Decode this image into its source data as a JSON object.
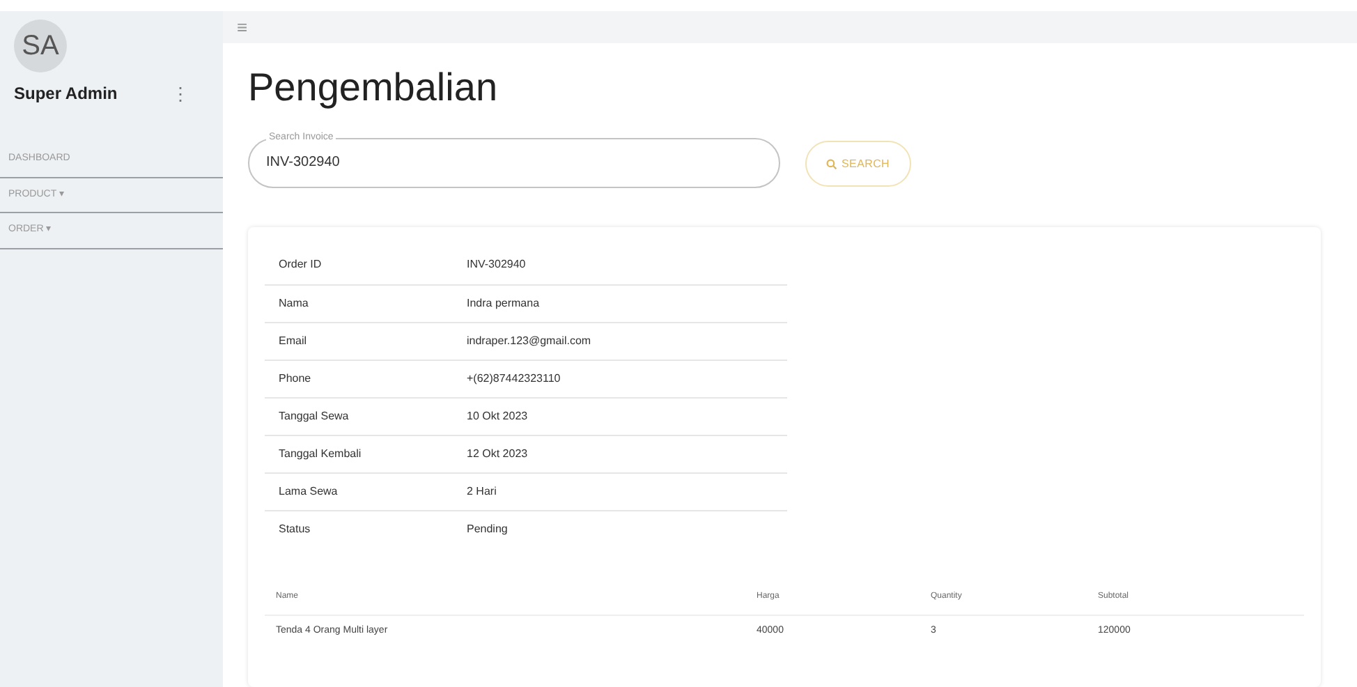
{
  "sidebar": {
    "avatar": "SA",
    "user": "Super Admin",
    "menu_icon": "⋮",
    "items": [
      {
        "label": "DASHBOARD"
      },
      {
        "label": "PRODUCT ▾"
      },
      {
        "label": "ORDER ▾"
      }
    ]
  },
  "topbar": {
    "menu_icon": "≡"
  },
  "title": "Pengembalian",
  "search": {
    "label": "Search Invoice",
    "value": "INV-302940",
    "button": "SEARCH"
  },
  "details": [
    {
      "label": "Order ID",
      "value": "INV-302940"
    },
    {
      "label": "Nama",
      "value": "Indra permana"
    },
    {
      "label": "Email",
      "value": "indraper.123@gmail.com"
    },
    {
      "label": "Phone",
      "value": "+(62)87442323110"
    },
    {
      "label": "Tanggal Sewa",
      "value": "10 Okt 2023"
    },
    {
      "label": "Tanggal Kembali",
      "value": "12 Okt 2023"
    },
    {
      "label": "Lama Sewa",
      "value": "2 Hari"
    },
    {
      "label": "Status",
      "value": "Pending"
    }
  ],
  "items_table": {
    "columns": [
      "Name",
      "Harga",
      "Quantity",
      "Subtotal"
    ],
    "rows": [
      [
        "Tenda 4 Orang Multi layer",
        "40000",
        "3",
        "120000"
      ]
    ]
  }
}
